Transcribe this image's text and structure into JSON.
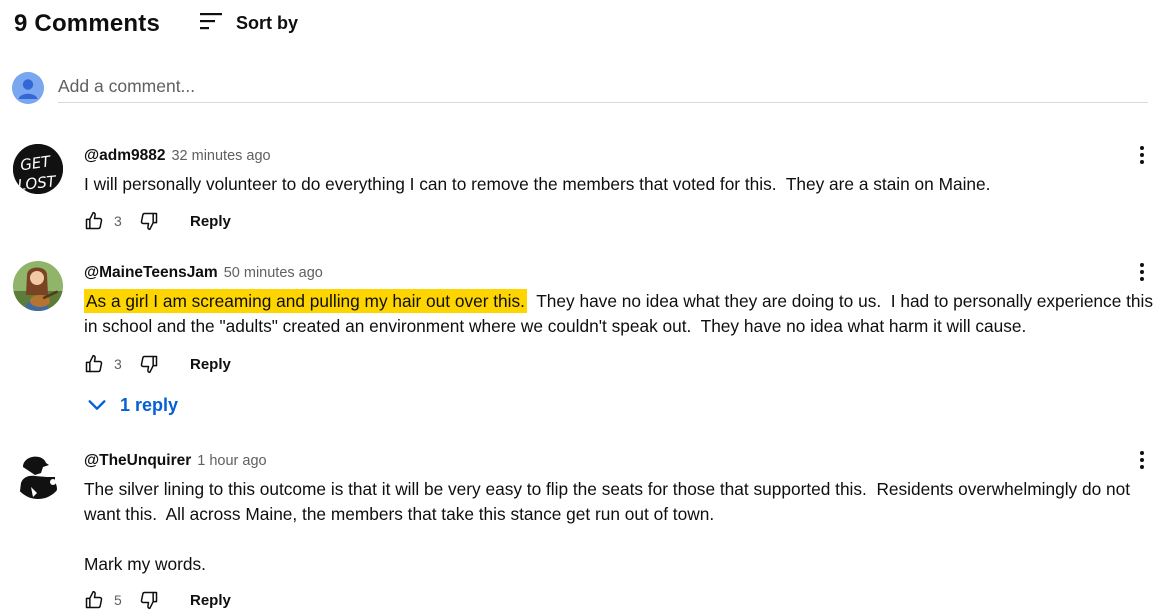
{
  "header": {
    "count_label": "9 Comments",
    "sort_label": "Sort by"
  },
  "add_comment": {
    "placeholder": "Add a comment..."
  },
  "comments": [
    {
      "author": "@adm9882",
      "time": "32 minutes ago",
      "avatar_text": "GET LOST",
      "text": "I will personally volunteer to do everything I can to remove the members that voted for this.  They are a stain on Maine.",
      "likes": "3",
      "reply_label": "Reply"
    },
    {
      "author": "@MaineTeensJam",
      "time": "50 minutes ago",
      "highlight": "As a girl I am screaming and pulling my hair out over this.",
      "text_line1_rest": "  They have no idea what they are doing to us.  I had to personally experience this",
      "text_line2": "in school and the \"adults\" created an environment where we couldn't speak out.  They have no idea what harm it will cause.",
      "likes": "3",
      "reply_label": "Reply",
      "replies_label": "1 reply"
    },
    {
      "author": "@TheUnquirer",
      "time": "1 hour ago",
      "text": "The silver lining to this outcome is that it will be very easy to flip the seats for those that supported this.  Residents overwhelmingly do not want this.  All across Maine, the members that take this stance get run out of town.\n\nMark my words.",
      "likes": "5",
      "reply_label": "Reply"
    }
  ],
  "colors": {
    "highlight": "#ffd500",
    "link_blue": "#065fd4",
    "secondary_text": "#606060"
  }
}
